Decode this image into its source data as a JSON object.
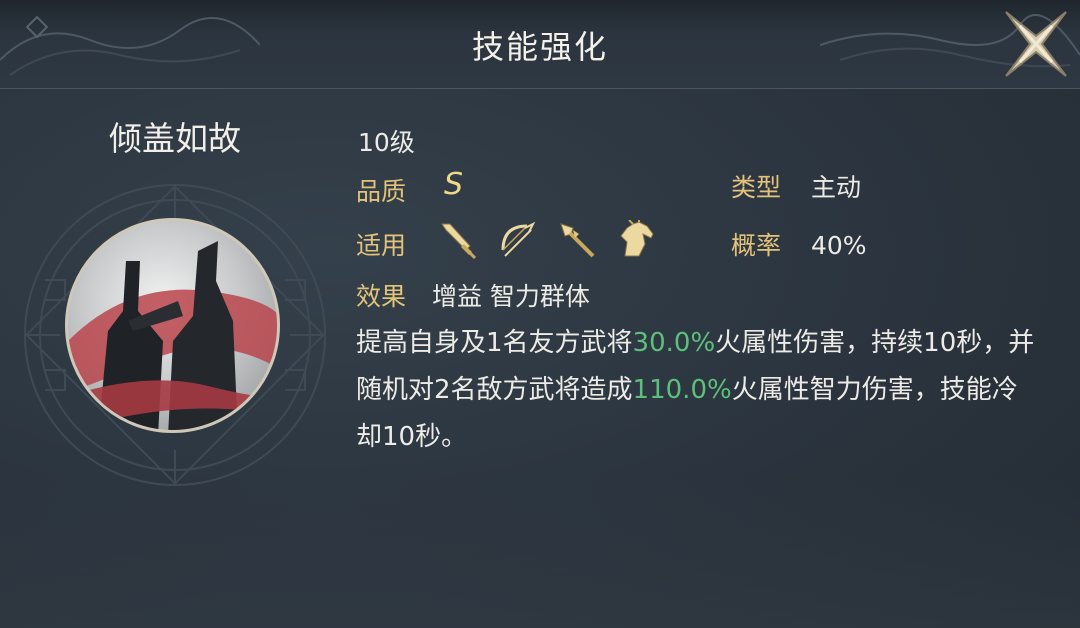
{
  "header": {
    "title": "技能强化"
  },
  "skill": {
    "name": "倾盖如故",
    "level": "10级",
    "quality_label": "品质",
    "quality_value": "S",
    "type_label": "类型",
    "type_value": "主动",
    "applies_label": "适用",
    "applies_icons": [
      "sword-icon",
      "bow-icon",
      "spear-icon",
      "horse-icon"
    ],
    "rate_label": "概率",
    "rate_value": "40%",
    "effect_label": "效果",
    "effect_value": "增益 智力群体",
    "description": {
      "part1": "提高自身及1名友方武将",
      "value1": "30.0%",
      "part2": "火属性伤害，持续10秒，并随机对2名敌方武将造成",
      "value2": "110.0%",
      "part3": "火属性智力伤害，技能冷却10秒。"
    }
  },
  "colors": {
    "label_gold": "#e3c37a",
    "highlight_green": "#5cc07a",
    "text_light": "#ecebe6",
    "background": "#2b343e"
  }
}
